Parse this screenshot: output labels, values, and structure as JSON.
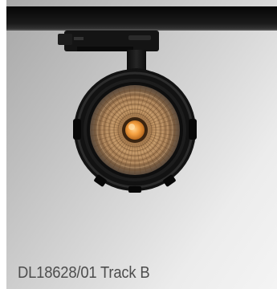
{
  "product": {
    "caption": "DL18628/01 Track B",
    "image_subject": "track-spotlight"
  },
  "colors": {
    "background_light": "#f4f4f4",
    "background_dark": "#a7a7a7",
    "fixture_body": "#151515",
    "led_core": "#f0a040",
    "reflector": "#b58a60",
    "caption_text": "#4d4d4d"
  }
}
